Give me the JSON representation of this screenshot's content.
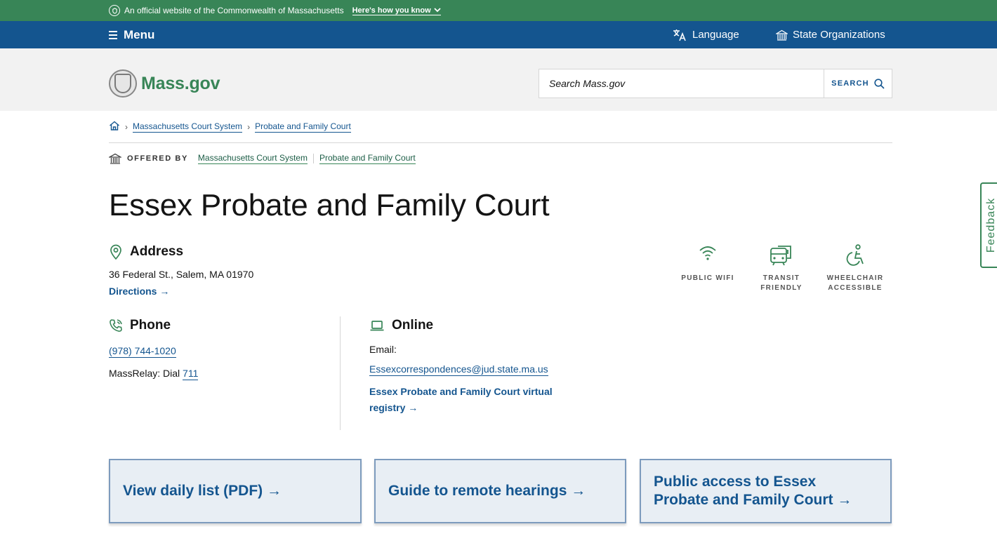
{
  "banner": {
    "text": "An official website of the Commonwealth of Massachusetts",
    "how_label": "Here's how you know"
  },
  "nav": {
    "menu_label": "Menu",
    "language_label": "Language",
    "orgs_label": "State Organizations"
  },
  "header": {
    "logo_text": "Mass.gov",
    "search_placeholder": "Search Mass.gov",
    "search_button": "SEARCH"
  },
  "breadcrumb": {
    "items": [
      "Massachusetts Court System",
      "Probate and Family Court"
    ]
  },
  "offered_by": {
    "label": "OFFERED BY",
    "orgs": [
      "Massachusetts Court System",
      "Probate and Family Court"
    ]
  },
  "page_title": "Essex Probate and Family Court",
  "address": {
    "heading": "Address",
    "line": "36 Federal St., Salem, MA 01970",
    "directions": "Directions →"
  },
  "amenities": [
    {
      "icon": "wifi-icon",
      "label": "PUBLIC WIFI"
    },
    {
      "icon": "transit-icon",
      "label": "TRANSIT FRIENDLY"
    },
    {
      "icon": "wheelchair-icon",
      "label": "WHEELCHAIR ACCESSIBLE"
    }
  ],
  "phone": {
    "heading": "Phone",
    "number": "(978) 744-1020",
    "relay_label": "MassRelay: Dial",
    "relay_number": "711"
  },
  "online": {
    "heading": "Online",
    "email_label": "Email:",
    "email": "Essexcorrespondences@jud.state.ma.us",
    "registry": "Essex Probate and Family Court virtual registry →"
  },
  "cards": [
    "View daily list (PDF) →",
    "Guide to remote hearings →",
    "Public access to Essex Probate and Family Court →"
  ],
  "feedback": "Feedback",
  "colors": {
    "green": "#388557",
    "blue": "#14558f"
  }
}
